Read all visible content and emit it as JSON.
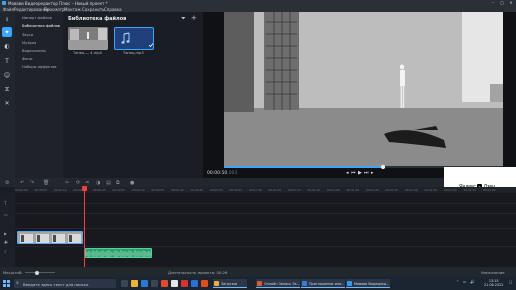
{
  "window": {
    "title": "Мовави Видеоредактор Плюс – Новый проект *",
    "controls": [
      "–",
      "▢",
      "✕"
    ]
  },
  "menu": [
    "Файл",
    "Редактирование",
    "Просмотр",
    "Монтаж",
    "Сохранить",
    "Справка"
  ],
  "tools": [
    {
      "icon": "import-icon",
      "glyph": "⭳"
    },
    {
      "icon": "magic-wand-icon",
      "glyph": "✦"
    },
    {
      "icon": "filters-icon",
      "glyph": "◐"
    },
    {
      "icon": "titles-icon",
      "glyph": "T"
    },
    {
      "icon": "stickers-icon",
      "glyph": "☺"
    },
    {
      "icon": "transitions-icon",
      "glyph": "⧖"
    },
    {
      "icon": "more-tools-icon",
      "glyph": "✕"
    }
  ],
  "categories": [
    {
      "label": "Импорт файлов",
      "selected": false
    },
    {
      "label": "Библиотека файлов",
      "selected": true
    },
    {
      "label": "Звуки",
      "selected": false
    },
    {
      "label": "Музыка",
      "selected": false
    },
    {
      "label": "Видеоклипы",
      "selected": false
    },
    {
      "label": "Фоны",
      "selected": false
    },
    {
      "label": "Наборы эффектов",
      "selected": false
    }
  ],
  "library": {
    "title": "Библиотека файлов",
    "items": [
      {
        "caption": "Танец — 4.mp4",
        "kind": "video"
      },
      {
        "caption": "Танец.mp3",
        "kind": "audio"
      }
    ]
  },
  "player": {
    "timecode_main": "00:00:50",
    "timecode_frac": ".003",
    "progress": 0.57
  },
  "ad": {
    "text": "Яндекс",
    "brand": "Дзен"
  },
  "timeline": {
    "ruler": [
      "00:00:00",
      "00:00:05",
      "00:00:10",
      "00:00:15",
      "00:00:20",
      "00:00:25",
      "00:00:30",
      "00:00:35",
      "00:00:40",
      "00:00:45",
      "00:00:50",
      "00:00:55",
      "00:01:00",
      "00:01:05",
      "00:01:10",
      "00:01:15",
      "00:01:20",
      "00:01:25",
      "00:01:30",
      "00:01:35",
      "00:01:40",
      "00:01:45",
      "00:01:50",
      "00:01:55",
      "00:02:00"
    ]
  },
  "status": {
    "zoom_label": "Масштаб:",
    "duration": "Длительность проекта: 00:26",
    "increase": "Увеличение"
  },
  "taskbar": {
    "search_placeholder": "Введите здесь текст для поиска",
    "tasks": [
      {
        "label": "Загрузки",
        "color": "#f0b233"
      },
      {
        "label": "Онлайн Запись Эк...",
        "color": "#e05a2b"
      },
      {
        "label": "Приглашение или...",
        "color": "#3a7bd5"
      },
      {
        "label": "Мовави Видеоред...",
        "color": "#2a9df4"
      }
    ],
    "time": "13:15",
    "date": "21.06.2022"
  },
  "colors": {
    "accent": "#3aa7ff",
    "playhead": "#ff3b3b",
    "audio_clip": "#2f9e6e"
  }
}
